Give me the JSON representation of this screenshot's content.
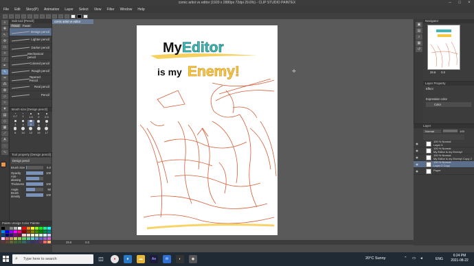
{
  "window": {
    "title": "comic artist vs editor (1920 x 2880px 72dpi 29.6%) - CLIP STUDIO PAINTEX"
  },
  "menu": [
    "File",
    "Edit",
    "Story(P)",
    "Animation",
    "Layer",
    "Select",
    "View",
    "Filter",
    "Window",
    "Help"
  ],
  "document_tab": "comic artist vs editor",
  "subtool": {
    "header": "Sub tool [Pencil]",
    "tabs": [
      "Pencil",
      "Pastel"
    ],
    "brushes": [
      {
        "label": "Design pencil",
        "selected": true
      },
      {
        "label": "Lighter pencil",
        "selected": false
      },
      {
        "label": "Darker pencil",
        "selected": false
      },
      {
        "label": "Mechanical pencil",
        "selected": false
      },
      {
        "label": "Colored pencil",
        "selected": false
      },
      {
        "label": "Rough pencil",
        "selected": false
      },
      {
        "label": "Tapered Pencil",
        "selected": false
      },
      {
        "label": "Real pencil",
        "selected": false
      },
      {
        "label": "Pencil",
        "selected": false
      }
    ]
  },
  "brush_size": {
    "header": "Brush size [Design pencil]",
    "sizes": [
      "0.7",
      "1",
      "1.5",
      "2",
      "2.5",
      "3",
      "4",
      "5",
      "6",
      "7",
      "8",
      "10",
      "12",
      "15",
      "17"
    ],
    "selected": "5"
  },
  "tool_property": {
    "header": "Tool property [Design pencil]",
    "tool_name": "Design pencil",
    "properties": [
      {
        "label": "Brush Size",
        "value": "5.0",
        "fill": 0.05
      },
      {
        "label": "Opacity",
        "value": "100",
        "fill": 1.0
      },
      {
        "label": "Anti-aliasing",
        "value": "",
        "fill": 0.75
      },
      {
        "label": "Thickness",
        "value": "100",
        "fill": 1.0
      },
      {
        "label": "Angle",
        "value": "90",
        "fill": 0.5
      },
      {
        "label": "Brush density",
        "value": "100",
        "fill": 1.0
      }
    ]
  },
  "palette": {
    "header": "Palets  Unsigs Color Palette"
  },
  "canvas": {
    "title_line1_prefix": "My",
    "title_line1_word": "Editor",
    "title_line2_prefix": "is my",
    "title_line2_word": "Enemy!"
  },
  "statusbar": {
    "zoom": "29.6",
    "angle": "0.0"
  },
  "navigator": {
    "header": "Navigator",
    "zoom": "29.6",
    "angle": "0.0"
  },
  "layer_property": {
    "header": "Layer Property",
    "effect_label": "Effect",
    "expression_label": "Expression color",
    "expression_value": "Color"
  },
  "layers": {
    "header": "Layer",
    "blend_mode": "Normal",
    "opacity": "100",
    "items": [
      {
        "line1": "100 % Normal",
        "line2": "Layer 3",
        "selected": false
      },
      {
        "line1": "100 % Normal",
        "line2": "My Editor is my Enemy!",
        "selected": false
      },
      {
        "line1": "100 % Normal",
        "line2": "My Editor is my Enemy! Copy 2",
        "selected": false
      },
      {
        "line1": "100 % Normal",
        "line2": "Layer 2 Copy",
        "selected": true
      },
      {
        "line1": "",
        "line2": "Paper",
        "selected": false
      }
    ]
  },
  "taskbar": {
    "search_placeholder": "Type here to search",
    "weather": "20°C  Sunny",
    "language": "ENG",
    "time": "6:24 PM",
    "date": "2021-08-22"
  },
  "colors": {
    "teal": "#3db8b5",
    "yellow": "#f5c842",
    "orange": "#e8973a",
    "sketch": "#d24a1e",
    "selection": "#5b6f8c"
  }
}
